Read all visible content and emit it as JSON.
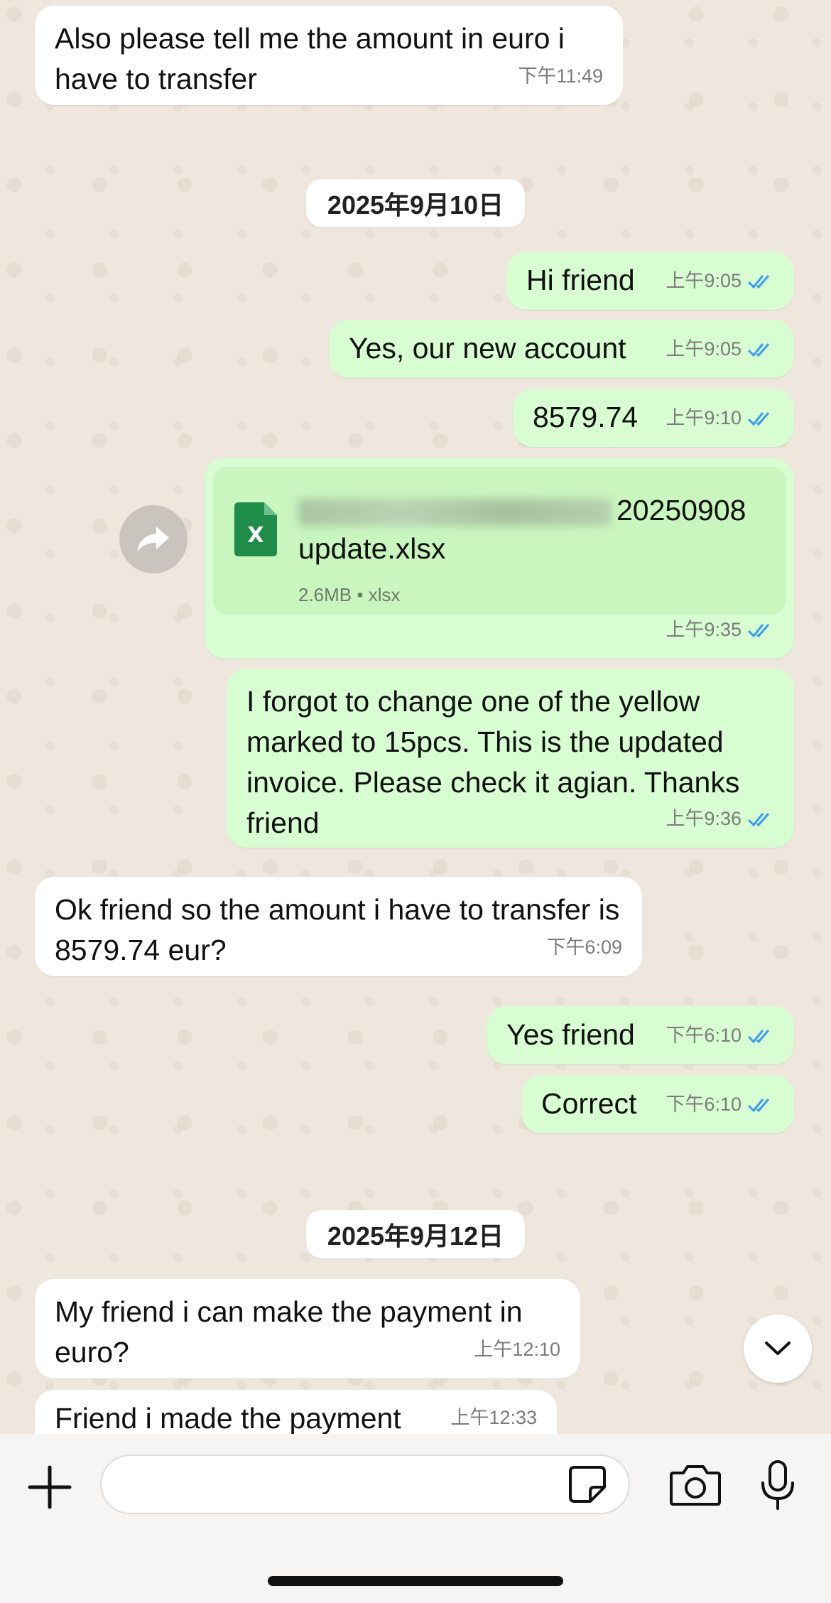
{
  "messages": [
    {
      "dir": "in",
      "text": "Also please tell me the amount in euro i have to transfer",
      "time": "下午11:49"
    },
    {
      "dir": "out",
      "text": "Hi friend",
      "time": "上午9:05"
    },
    {
      "dir": "out",
      "text": "Yes, our new account",
      "time": "上午9:05"
    },
    {
      "dir": "out",
      "text": "8579.74",
      "time": "上午9:10"
    },
    {
      "dir": "out",
      "text": "I forgot to change one of the yellow marked to 15pcs. This is the updated invoice. Please check it agian. Thanks friend",
      "time": "上午9:36"
    },
    {
      "dir": "in",
      "text": "Ok friend so the amount i have to transfer is 8579.74 eur?",
      "time": "下午6:09"
    },
    {
      "dir": "out",
      "text": "Yes friend",
      "time": "下午6:10"
    },
    {
      "dir": "out",
      "text": "Correct",
      "time": "下午6:10"
    },
    {
      "dir": "in",
      "text": "My friend i can make the payment in euro?",
      "time": "上午12:10"
    },
    {
      "dir": "in",
      "text": "Friend i made the payment",
      "time": "上午12:33"
    }
  ],
  "dates": [
    "2025年9月10日",
    "2025年9月12日"
  ],
  "file_message": {
    "name_visible": "20250908 update.xlsx",
    "size": "2.6MB",
    "ext": "xlsx",
    "time": "上午9:35",
    "icon": "excel-file-icon"
  },
  "colors": {
    "incoming": "#ffffff",
    "outgoing": "#d8fdd2",
    "read_ticks": "#3b9cf0"
  },
  "composer": {
    "placeholder": ""
  }
}
